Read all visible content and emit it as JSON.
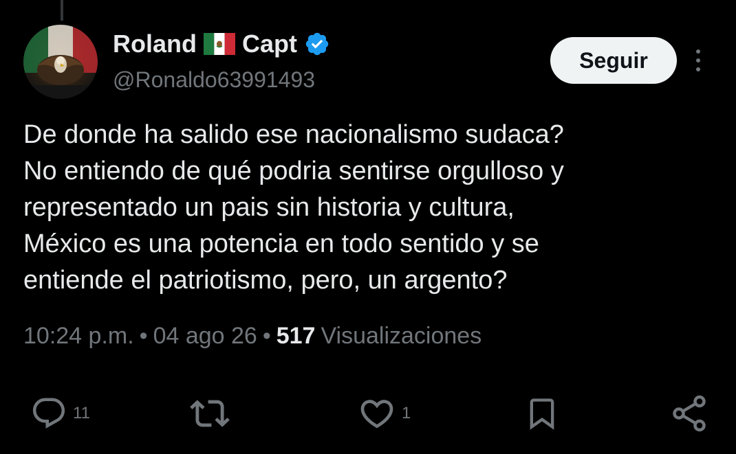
{
  "user": {
    "name_part1": "Roland",
    "name_flag_icon": "mexico-flag-emoji",
    "name_part2": "Capt",
    "verified_icon": "verified-badge-icon",
    "handle": "@Ronaldo63991493",
    "avatar_icon": "eagle-mexico-flag-avatar"
  },
  "follow_button": {
    "label": "Seguir"
  },
  "more_icon": "more-vertical-icon",
  "tweet": {
    "text_lines": [
      "De donde ha salido ese nacionalismo sudaca?",
      "No entiendo de qué podria sentirse orgulloso y",
      "representado un pais sin historia y cultura,",
      "México es una potencia en todo sentido y se",
      "entiende el patriotismo, pero, un argento?"
    ],
    "time": "10:24 p.m.",
    "separator": "•",
    "date": "04 ago 26",
    "views_count": "517",
    "views_label": "Visualizaciones"
  },
  "actions": {
    "reply": {
      "icon": "reply-icon",
      "count": "11"
    },
    "retweet": {
      "icon": "retweet-icon",
      "count": ""
    },
    "like": {
      "icon": "heart-icon",
      "count": "1"
    },
    "bookmark": {
      "icon": "bookmark-icon",
      "count": ""
    },
    "share": {
      "icon": "share-icon",
      "count": ""
    }
  },
  "colors": {
    "background": "#000000",
    "primary_text": "#e7e9ea",
    "secondary_text": "#71767b",
    "verified_blue": "#1d9bf0",
    "button_bg": "#eff3f4",
    "button_text": "#0f1419"
  }
}
